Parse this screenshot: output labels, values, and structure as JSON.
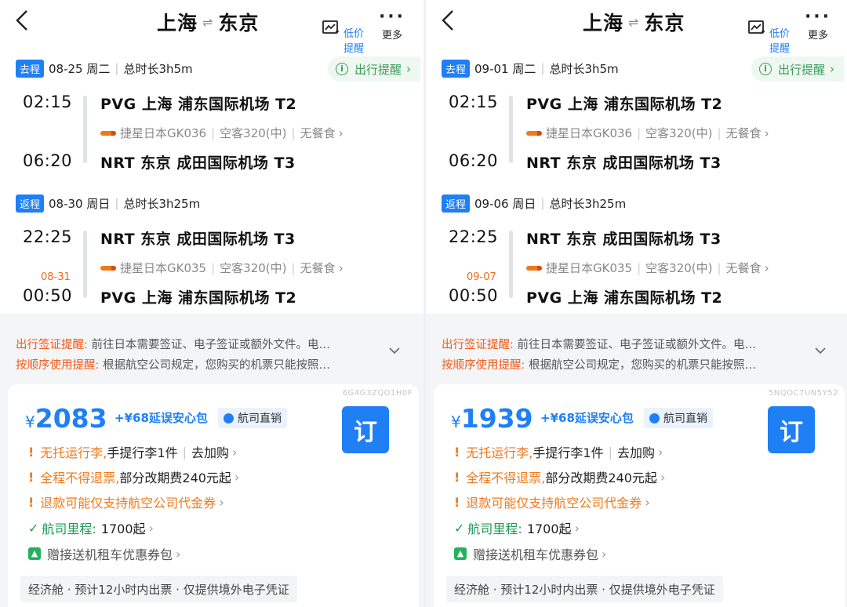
{
  "header": {
    "route_from": "上海",
    "route_sep": "⇌",
    "route_to": "东京",
    "price_alert_label": "低价提醒",
    "more_label": "更多"
  },
  "panels": [
    {
      "outbound": {
        "tag": "去程",
        "date": "08-25 周二",
        "duration": "总时长3h5m",
        "reminder": "出行提醒",
        "dep_time": "02:15",
        "dep_airport": "PVG 上海 浦东国际机场 T2",
        "flight_info": "捷星日本GK036",
        "aircraft": "空客320(中)",
        "meal": "无餐食",
        "arr_time": "06:20",
        "arr_airport": "NRT 东京 成田国际机场 T3"
      },
      "return": {
        "tag": "返程",
        "date": "08-30 周日",
        "duration": "总时长3h25m",
        "dep_time": "22:25",
        "dep_airport": "NRT 东京 成田国际机场 T3",
        "flight_info": "捷星日本GK035",
        "aircraft": "空客320(中)",
        "meal": "无餐食",
        "arr_date": "08-31",
        "arr_time": "00:50",
        "arr_airport": "PVG 上海 浦东国际机场 T2"
      },
      "notices": [
        {
          "label": "出行签证提醒:",
          "text": " 前往日本需要签证、电子签证或额外文件。电…"
        },
        {
          "label": "按顺序使用提醒:",
          "text": " 根据航空公司规定，您购买的机票只能按照…"
        }
      ],
      "card": {
        "code": "6G4G3ZQO1H0F",
        "currency": "¥",
        "price": "2083",
        "addon": "+¥68延误安心包",
        "direct": "航司直销",
        "book": "订",
        "baggage_a": "无托运行李,",
        "baggage_b": "手提行李1件",
        "baggage_c": "去加购",
        "refund_a": "全程不得退票,",
        "refund_b": "部分改期费240元起",
        "voucher": "退款可能仅支持航空公司代金券",
        "miles_a": "航司里程:",
        "miles_b": "1700起",
        "gift": "赠接送机租车优惠券包",
        "footer": "经济舱 · 预计12小时内出票 · 仅提供境外电子凭证"
      }
    },
    {
      "outbound": {
        "tag": "去程",
        "date": "09-01 周二",
        "duration": "总时长3h5m",
        "reminder": "出行提醒",
        "dep_time": "02:15",
        "dep_airport": "PVG 上海 浦东国际机场 T2",
        "flight_info": "捷星日本GK036",
        "aircraft": "空客320(中)",
        "meal": "无餐食",
        "arr_time": "06:20",
        "arr_airport": "NRT 东京 成田国际机场 T3"
      },
      "return": {
        "tag": "返程",
        "date": "09-06 周日",
        "duration": "总时长3h25m",
        "dep_time": "22:25",
        "dep_airport": "NRT 东京 成田国际机场 T3",
        "flight_info": "捷星日本GK035",
        "aircraft": "空客320(中)",
        "meal": "无餐食",
        "arr_date": "09-07",
        "arr_time": "00:50",
        "arr_airport": "PVG 上海 浦东国际机场 T2"
      },
      "notices": [
        {
          "label": "出行签证提醒:",
          "text": " 前往日本需要签证、电子签证或额外文件。电…"
        },
        {
          "label": "按顺序使用提醒:",
          "text": " 根据航空公司规定，您购买的机票只能按照…"
        }
      ],
      "card": {
        "code": "5NQOC7UN5Y52",
        "currency": "¥",
        "price": "1939",
        "addon": "+¥68延误安心包",
        "direct": "航司直销",
        "book": "订",
        "baggage_a": "无托运行李,",
        "baggage_b": "手提行李1件",
        "baggage_c": "去加购",
        "refund_a": "全程不得退票,",
        "refund_b": "部分改期费240元起",
        "voucher": "退款可能仅支持航空公司代金券",
        "miles_a": "航司里程:",
        "miles_b": "1700起",
        "gift": "赠接送机租车优惠券包",
        "footer": "经济舱 · 预计12小时内出票 · 仅提供境外电子凭证"
      }
    }
  ]
}
